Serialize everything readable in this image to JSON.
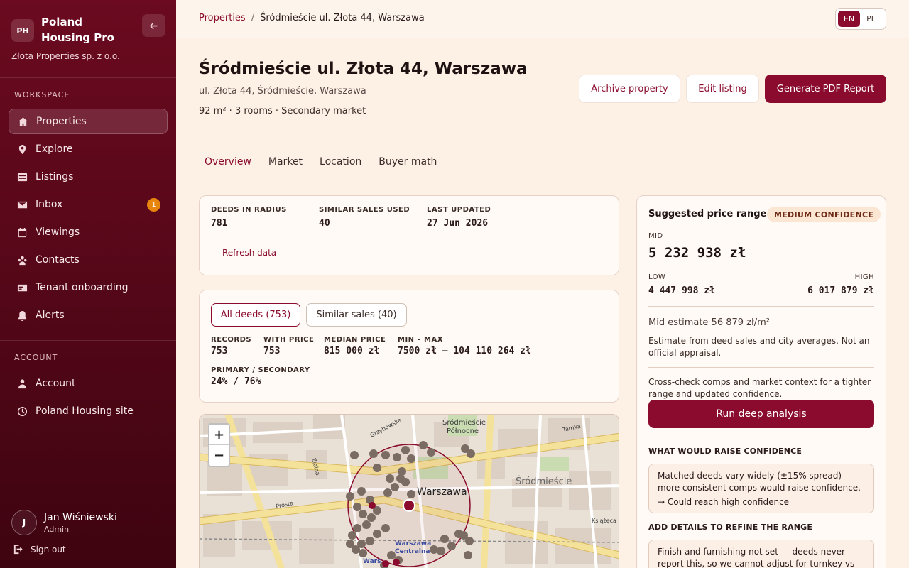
{
  "sidebar": {
    "logo": "PH",
    "brand": "Poland Housing Pro",
    "company": "Złota Properties sp. z o.o.",
    "workspace_label": "WORKSPACE",
    "account_label": "ACCOUNT",
    "nav": [
      {
        "label": "Properties",
        "icon": "home-icon",
        "active": true
      },
      {
        "label": "Explore",
        "icon": "map-pin-icon"
      },
      {
        "label": "Listings",
        "icon": "list-icon"
      },
      {
        "label": "Inbox",
        "icon": "inbox-icon",
        "badge": "1"
      },
      {
        "label": "Viewings",
        "icon": "calendar-icon"
      },
      {
        "label": "Contacts",
        "icon": "contacts-icon"
      },
      {
        "label": "Tenant onboarding",
        "icon": "id-card-icon"
      },
      {
        "label": "Alerts",
        "icon": "bell-icon"
      }
    ],
    "account_nav": [
      {
        "label": "Account",
        "icon": "user-icon"
      },
      {
        "label": "Poland Housing site",
        "icon": "clock-icon"
      }
    ],
    "user": {
      "initial": "J",
      "name": "Jan Wiśniewski",
      "role": "Admin"
    },
    "signout": "Sign out"
  },
  "topbar": {
    "breadcrumb_root": "Properties",
    "breadcrumb_sep": "/",
    "breadcrumb_current": "Śródmieście ul. Złota 44, Warszawa",
    "lang_en": "EN",
    "lang_pl": "PL",
    "lang_active": "EN"
  },
  "property": {
    "title": "Śródmieście ul. Złota 44, Warszawa",
    "address": "ul. Złota 44, Śródmieście, Warszawa",
    "meta": "92 m² · 3 rooms · Secondary market",
    "archive": "Archive property",
    "edit": "Edit listing",
    "pdf": "Generate PDF Report"
  },
  "tabs": [
    "Overview",
    "Market",
    "Location",
    "Buyer math"
  ],
  "stats": {
    "deeds_label": "DEEDS IN RADIUS",
    "deeds_value": "781",
    "similar_label": "SIMILAR SALES USED",
    "similar_value": "40",
    "updated_label": "LAST UPDATED",
    "updated_value": "27 Jun 2026",
    "refresh": "Refresh data"
  },
  "deeds": {
    "filter_all": "All deeds (753)",
    "filter_similar": "Similar sales (40)",
    "records_label": "RECORDS",
    "records_value": "753",
    "with_price_label": "WITH PRICE",
    "with_price_value": "753",
    "median_label": "MEDIAN PRICE",
    "median_value": "815 000 zł",
    "minmax_label": "MIN – MAX",
    "minmax_value": "7500 zł – 104 110 264 zł",
    "ps_label": "PRIMARY / SECONDARY",
    "ps_value": "24% / 76%"
  },
  "map": {
    "zoom_in": "+",
    "zoom_out": "−",
    "labels": [
      "Śródmieście",
      "Północne",
      "Grzybowska",
      "Tamka",
      "Śródmieście",
      "Warszawa",
      "Zielna",
      "Prosta",
      "Książęca",
      "Warszawa",
      "Centralna",
      "Wars"
    ]
  },
  "price": {
    "title": "Suggested price range",
    "confidence": "MEDIUM CONFIDENCE",
    "mid_label": "MID",
    "mid_value": "5 232 938 zł",
    "low_label": "LOW",
    "low_value": "4 447 998 zł",
    "high_label": "HIGH",
    "high_value": "6 017 879 zł",
    "mid_estimate": "Mid estimate 56 879 zł/m²",
    "disclaimer": "Estimate from deed sales and city averages. Not an official appraisal.",
    "crosscheck": "Cross-check comps and market context for a tighter range and updated confidence.",
    "run": "Run deep analysis",
    "raise_head": "WHAT WOULD RAISE CONFIDENCE",
    "raise_text": "Matched deeds vary widely (±15% spread) — more consistent comps would raise confidence.",
    "raise_arrow": "→ Could reach high confidence",
    "add_head": "ADD DETAILS TO REFINE THE RANGE",
    "add_text": "Finish and furnishing not set — deeds never report this, so we cannot adjust for turnkey vs shell."
  },
  "colors": {
    "brand": "#8a0b2d",
    "badge": "#e8850f",
    "background": "#fdf1e6"
  }
}
